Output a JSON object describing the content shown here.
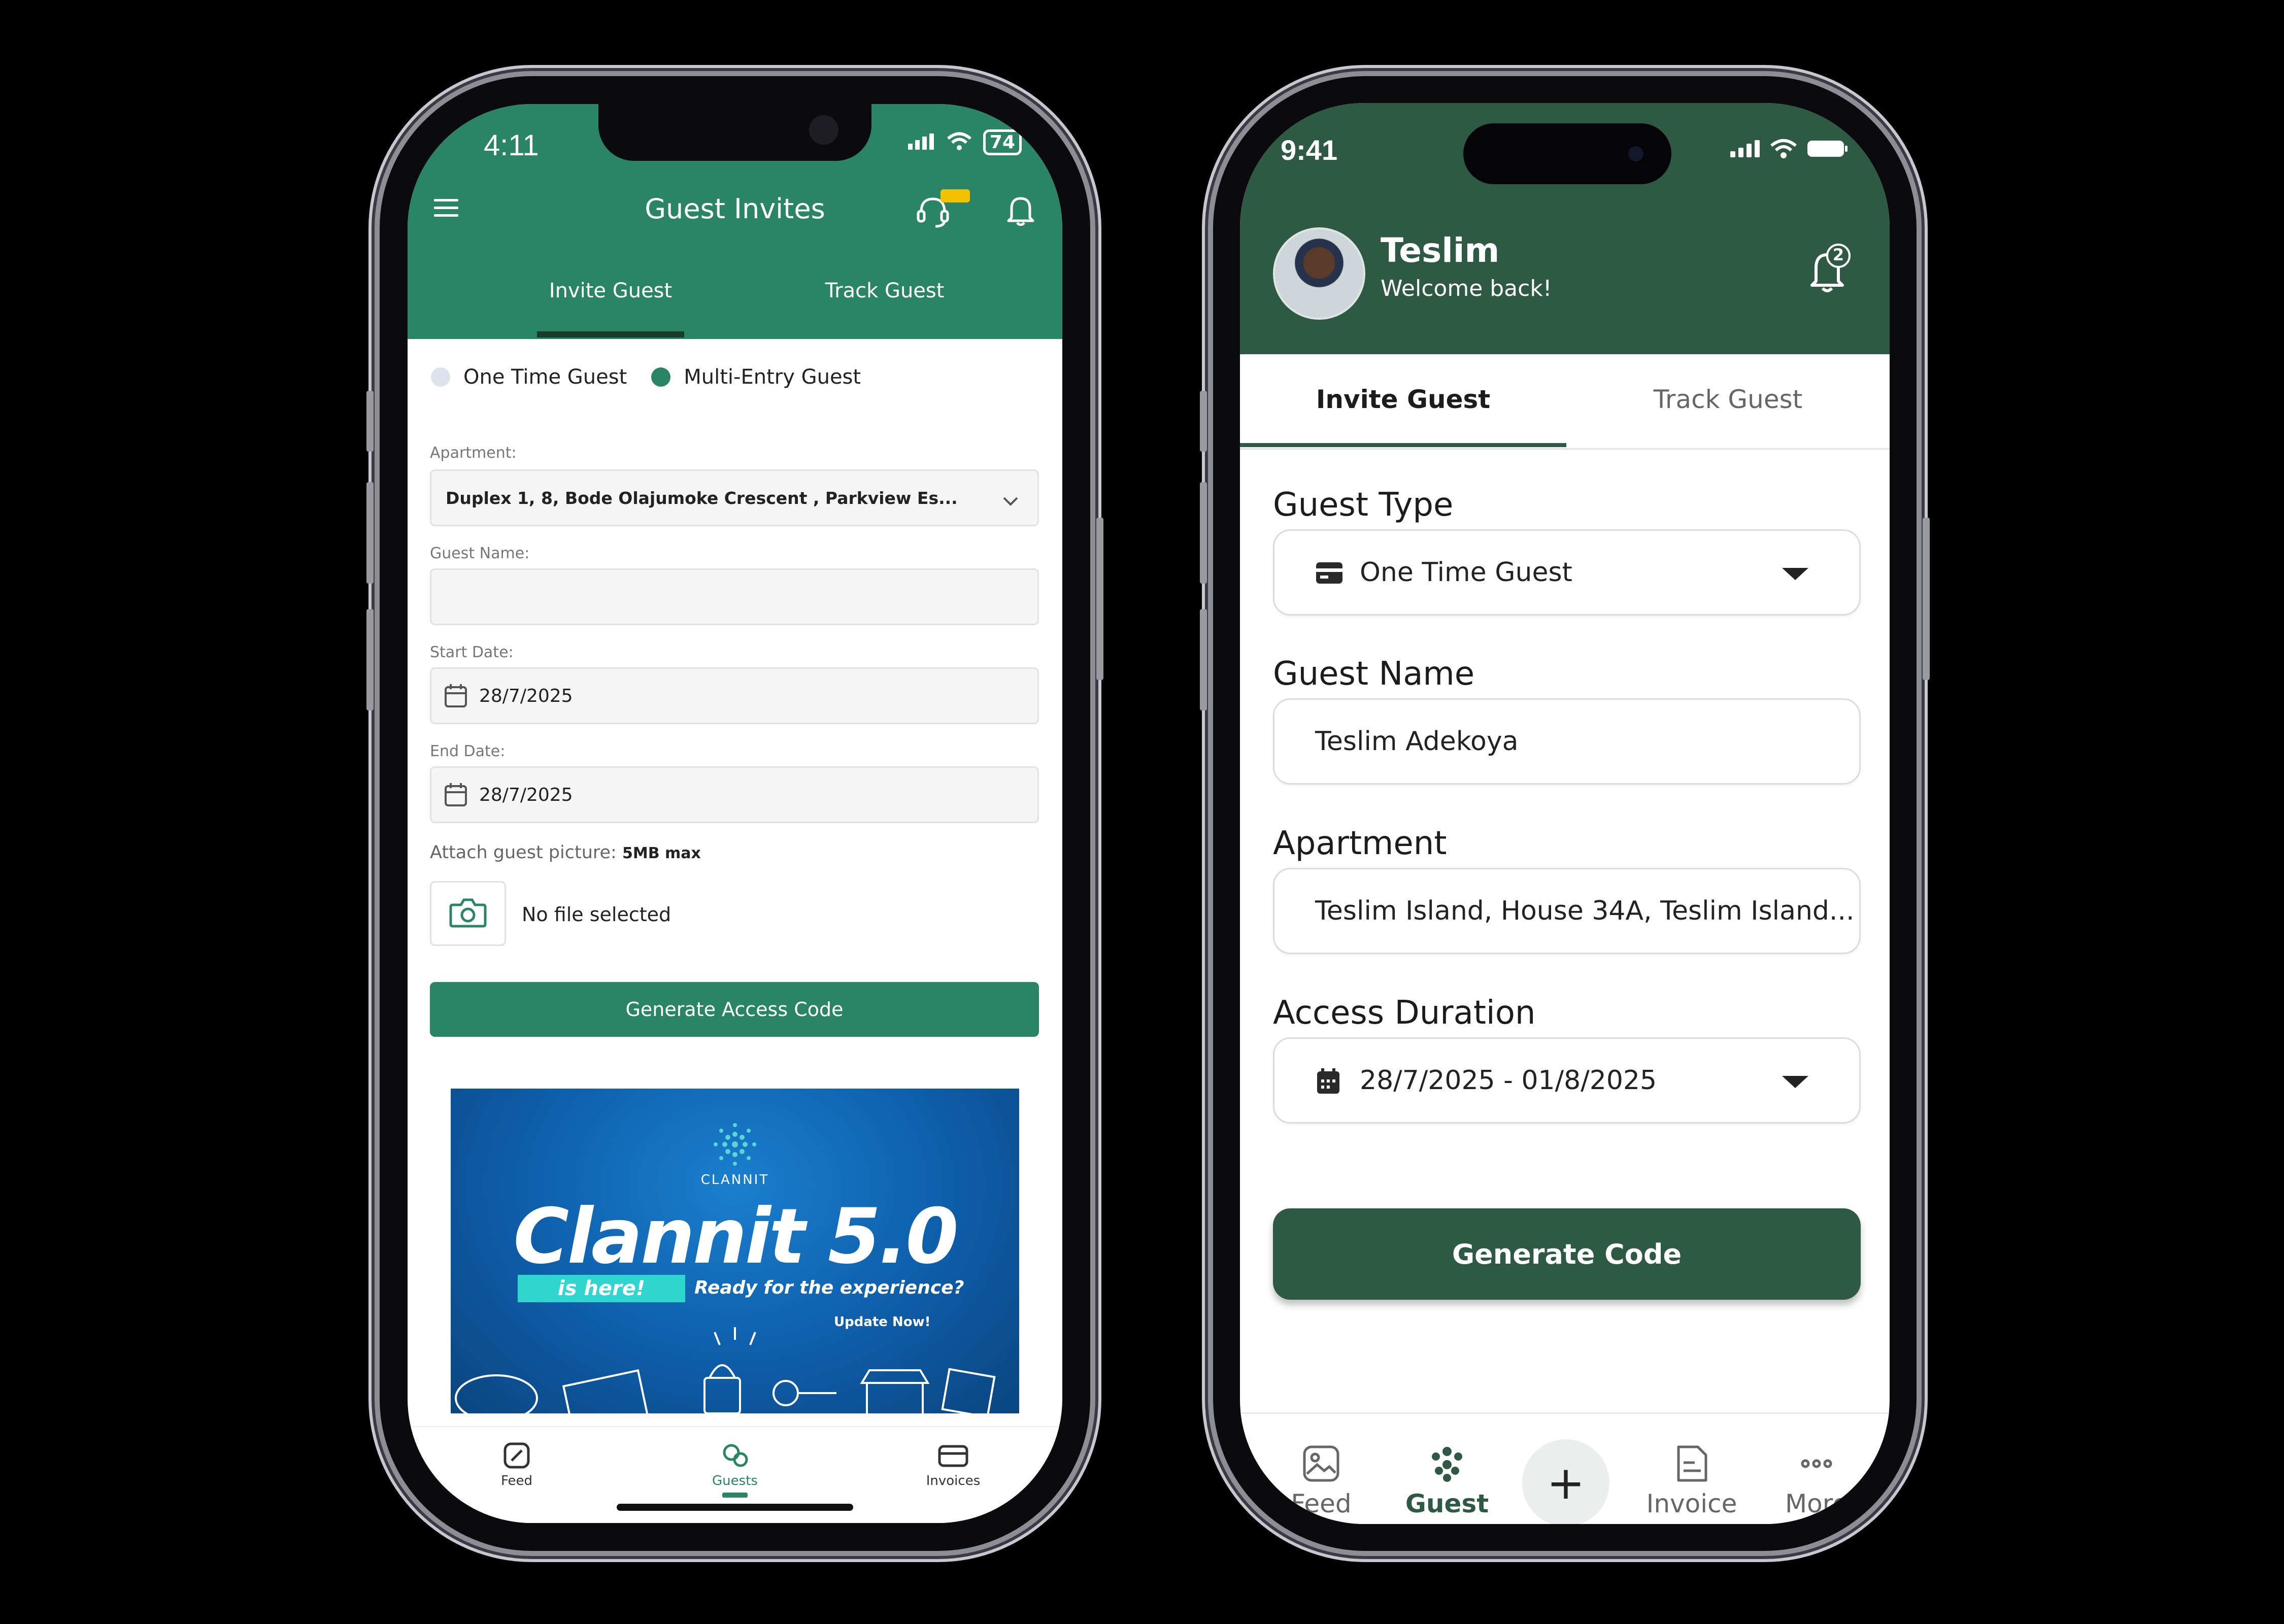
{
  "left": {
    "status": {
      "time": "4:11",
      "battery": "74"
    },
    "header": {
      "title": "Guest Invites"
    },
    "tabs": [
      {
        "label": "Invite Guest"
      },
      {
        "label": "Track Guest"
      }
    ],
    "guest_types": [
      {
        "label": "One Time Guest",
        "selected": false
      },
      {
        "label": "Multi-Entry Guest",
        "selected": true
      }
    ],
    "form": {
      "apartment_label": "Apartment:",
      "apartment_value": "Duplex 1, 8, Bode Olajumoke Crescent , Parkview Es...",
      "guest_name_label": "Guest Name:",
      "guest_name_value": "",
      "start_date_label": "Start Date:",
      "start_date_value": "28/7/2025",
      "end_date_label": "End Date:",
      "end_date_value": "28/7/2025",
      "attach_label": "Attach guest picture:",
      "attach_limit": "5MB max",
      "file_status": "No file selected"
    },
    "generate_button": "Generate Access Code",
    "banner": {
      "brand": "CLANNIT",
      "headline": "Clannit 5.0",
      "tag": "is here!",
      "subline": "Ready for the experience?",
      "cta": "Update Now!"
    },
    "bottom_nav": [
      {
        "label": "Feed"
      },
      {
        "label": "Guests"
      },
      {
        "label": "Invoices"
      }
    ],
    "colors": {
      "primary": "#2a8466",
      "dark": "#1a3a2c",
      "badge": "#f2c200"
    }
  },
  "right": {
    "status": {
      "time": "9:41"
    },
    "user": {
      "name": "Teslim",
      "greeting": "Welcome back!"
    },
    "notification_count": "2",
    "tabs": [
      {
        "label": "Invite Guest"
      },
      {
        "label": "Track Guest"
      }
    ],
    "form": {
      "guest_type_label": "Guest Type",
      "guest_type_value": "One Time Guest",
      "guest_name_label": "Guest Name",
      "guest_name_value": "Teslim Adekoya",
      "apartment_label": "Apartment",
      "apartment_value": "Teslim Island, House 34A, Teslim Island...",
      "duration_label": "Access Duration",
      "duration_value": "28/7/2025 - 01/8/2025"
    },
    "generate_button": "Generate Code",
    "bottom_nav": [
      {
        "label": "Feed"
      },
      {
        "label": "Guest"
      },
      {
        "label": "Invoice"
      },
      {
        "label": "More"
      }
    ],
    "plus_symbol": "+",
    "colors": {
      "primary": "#2e5945"
    }
  }
}
